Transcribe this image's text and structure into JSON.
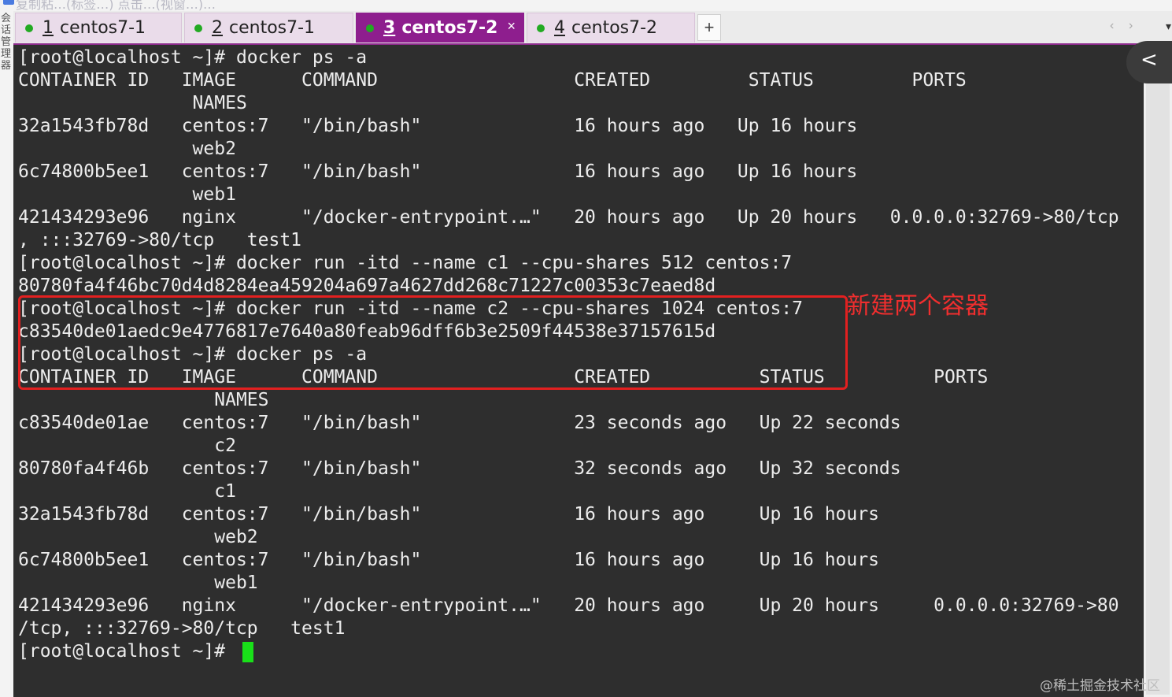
{
  "window": {
    "title_faded": "复制粘…(标签…) 点击…(视窗…)…",
    "side_tab_label": "会话管理器"
  },
  "tabs": [
    {
      "number": "1",
      "name": "centos7-1",
      "active": false
    },
    {
      "number": "2",
      "name": "centos7-1",
      "active": false
    },
    {
      "number": "3",
      "name": "centos7-2",
      "active": true
    },
    {
      "number": "4",
      "name": "centos7-2",
      "active": false
    }
  ],
  "tab_controls": {
    "new_tab": "+",
    "close": "×",
    "prev": "‹",
    "next": "›",
    "menu": "▾"
  },
  "terminal": {
    "lines": [
      "[root@localhost ~]# docker ps -a",
      "CONTAINER ID   IMAGE      COMMAND                  CREATED         STATUS         PORTS",
      "                NAMES",
      "32a1543fb78d   centos:7   \"/bin/bash\"              16 hours ago   Up 16 hours",
      "                web2",
      "6c74800b5ee1   centos:7   \"/bin/bash\"              16 hours ago   Up 16 hours",
      "                web1",
      "421434293e96   nginx      \"/docker-entrypoint.…\"   20 hours ago   Up 20 hours   0.0.0.0:32769->80/tcp",
      ", :::32769->80/tcp   test1",
      "[root@localhost ~]# docker run -itd --name c1 --cpu-shares 512 centos:7",
      "80780fa4f46bc70d4d8284ea459204a697a4627dd268c71227c00353c7eaed8d",
      "[root@localhost ~]# docker run -itd --name c2 --cpu-shares 1024 centos:7",
      "c83540de01aedc9e4776817e7640a80feab96dff6b3e2509f44538e37157615d",
      "[root@localhost ~]# docker ps -a",
      "CONTAINER ID   IMAGE      COMMAND                  CREATED          STATUS          PORTS",
      "                  NAMES",
      "c83540de01ae   centos:7   \"/bin/bash\"              23 seconds ago   Up 22 seconds",
      "                  c2",
      "80780fa4f46b   centos:7   \"/bin/bash\"              32 seconds ago   Up 32 seconds",
      "                  c1",
      "32a1543fb78d   centos:7   \"/bin/bash\"              16 hours ago     Up 16 hours",
      "                  web2",
      "6c74800b5ee1   centos:7   \"/bin/bash\"              16 hours ago     Up 16 hours",
      "                  web1",
      "421434293e96   nginx      \"/docker-entrypoint.…\"   20 hours ago     Up 20 hours     0.0.0.0:32769->80",
      "/tcp, :::32769->80/tcp   test1",
      "[root@localhost ~]# "
    ]
  },
  "annotation": {
    "text": "新建两个容器",
    "color": "#f02e2e"
  },
  "watermark": "@稀土掘金技术社区",
  "colors": {
    "terminal_bg": "#2e2e2e",
    "terminal_fg": "#ececec",
    "active_tab": "#8e1e8e",
    "cursor": "#19e019",
    "highlight": "#e32020"
  }
}
